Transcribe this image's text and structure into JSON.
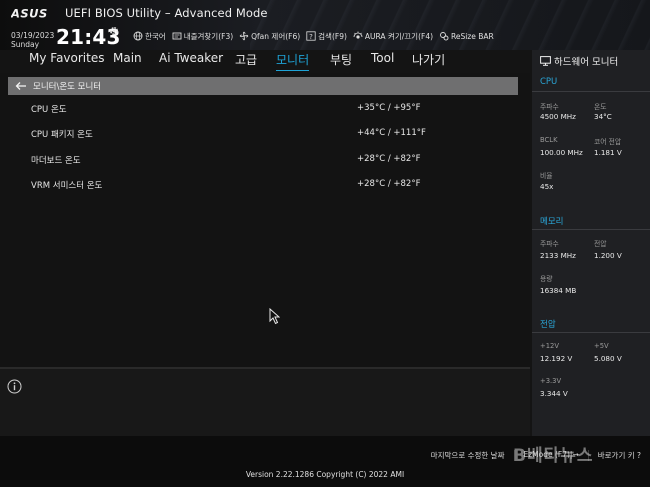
{
  "header": {
    "brand": "ASUS",
    "title": "UEFI BIOS Utility – Advanced Mode",
    "date": "03/19/2023",
    "day": "Sunday",
    "time": "21:43",
    "toolbar": [
      {
        "icon": "globe-icon",
        "label": "한국어"
      },
      {
        "icon": "favorites-icon",
        "label": "내즐겨찾기(F3)"
      },
      {
        "icon": "fan-icon",
        "label": "Qfan 제어(F6)"
      },
      {
        "icon": "help-icon",
        "label": "검색(F9)"
      },
      {
        "icon": "aura-icon",
        "label": "AURA 켜기/끄기(F4)"
      },
      {
        "icon": "resize-bar-icon",
        "label": "ReSize BAR"
      }
    ]
  },
  "nav": {
    "tabs": [
      "My Favorites",
      "Main",
      "Ai Tweaker",
      "고급",
      "모니터",
      "부팅",
      "Tool",
      "나가기"
    ],
    "active": "모니터"
  },
  "main": {
    "breadcrumb": "모니터\\온도 모니터",
    "rows": [
      {
        "label": "CPU 온도",
        "value": "+35°C / +95°F"
      },
      {
        "label": "CPU 패키지 온도",
        "value": "+44°C / +111°F"
      },
      {
        "label": "마더보드 온도",
        "value": "+28°C / +82°F"
      },
      {
        "label": "VRM 서미스터 온도",
        "value": "+28°C / +82°F"
      }
    ]
  },
  "hw": {
    "title": "하드웨어 모니터",
    "cpu": {
      "heading": "CPU",
      "freq_label": "주파수",
      "freq": "4500 MHz",
      "temp_label": "온도",
      "temp": "34°C",
      "bclk_label": "BCLK",
      "bclk": "100.00 MHz",
      "vcore_label": "코어 전압",
      "vcore": "1.181 V",
      "ratio_label": "비율",
      "ratio": "45x"
    },
    "memory": {
      "heading": "메모리",
      "freq_label": "주파수",
      "freq": "2133 MHz",
      "volt_label": "전압",
      "volt": "1.200 V",
      "cap_label": "용량",
      "cap": "16384 MB"
    },
    "voltage": {
      "heading": "전압",
      "v12_label": "+12V",
      "v12": "12.192 V",
      "v5_label": "+5V",
      "v5": "5.080 V",
      "v33_label": "+3.3V",
      "v33": "3.344 V"
    }
  },
  "footer": {
    "last_modified": "마지막으로 수정한 날짜",
    "ezmode": "EzMode (F7)|→",
    "hotkeys": "바로가기 키 ?",
    "copyright": "Version 2.22.1286 Copyright (C) 2022 AMI",
    "watermark": "B베타뉴스"
  },
  "colors": {
    "accent": "#1ea3d6",
    "panel": "#1f2023",
    "background": "#131313"
  }
}
